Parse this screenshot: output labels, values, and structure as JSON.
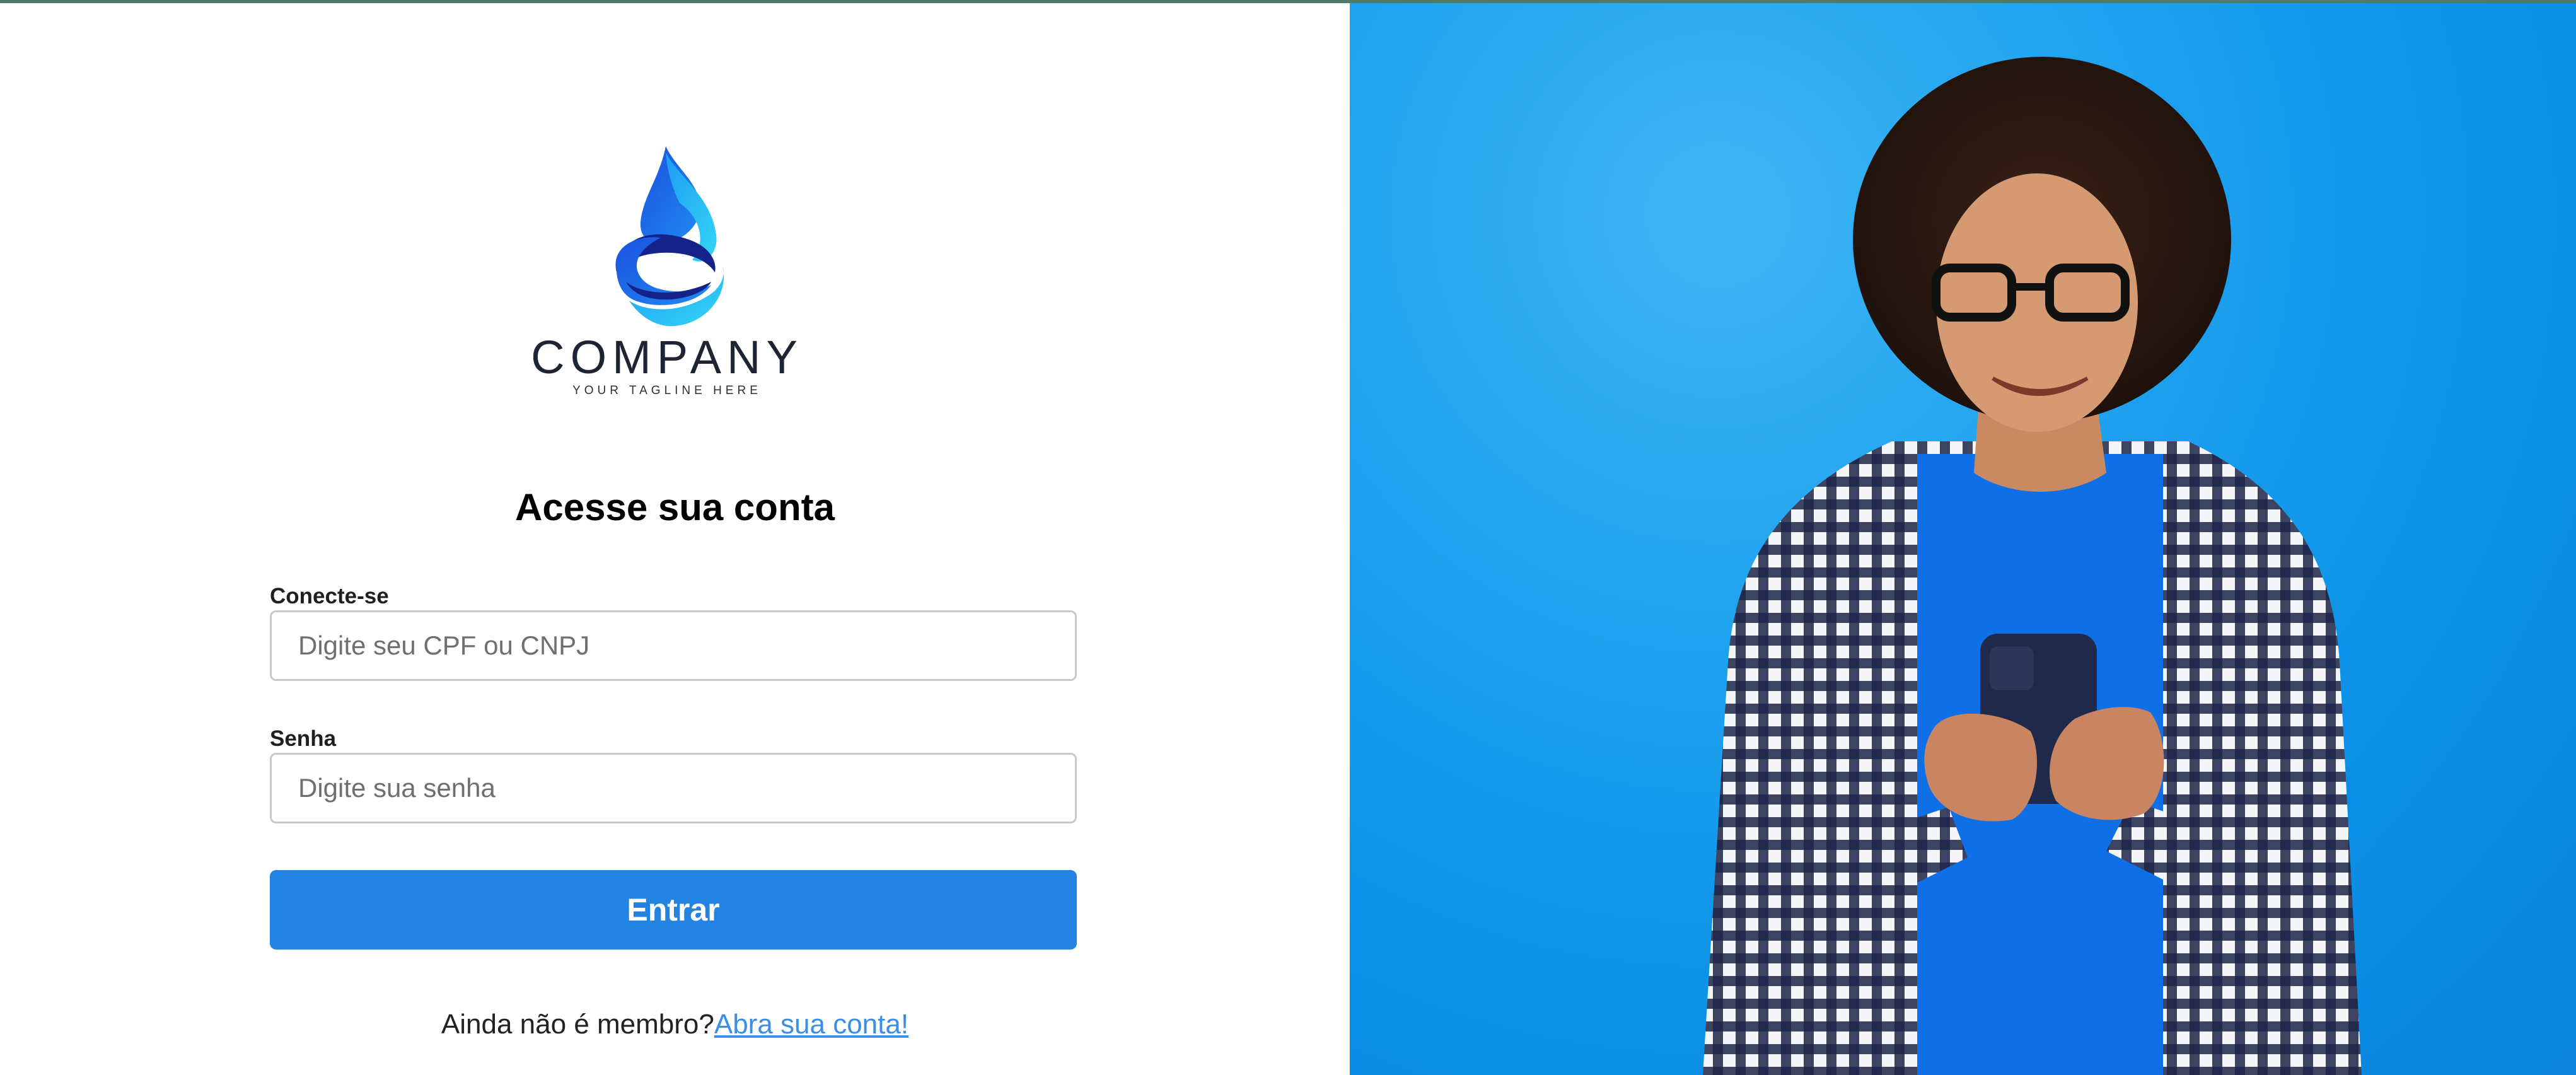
{
  "brand": {
    "name": "COMPANY",
    "tagline": "YOUR TAGLINE HERE",
    "colors": {
      "accent": "#2283e0",
      "logo_blue": "#1c6fe8",
      "logo_cyan": "#22c3f3",
      "logo_navy": "#14238a",
      "hero_background": "#1ea2ef"
    }
  },
  "login": {
    "title": "Acesse sua conta",
    "username": {
      "label": "Conecte-se",
      "placeholder": "Digite seu CPF ou CNPJ",
      "value": ""
    },
    "password": {
      "label": "Senha",
      "placeholder": "Digite sua senha",
      "value": ""
    },
    "submit_label": "Entrar",
    "signup_prompt": "Ainda não é membro?",
    "signup_link": "Abra sua conta!"
  },
  "hero": {
    "image": "smiling-man-holding-phone"
  }
}
